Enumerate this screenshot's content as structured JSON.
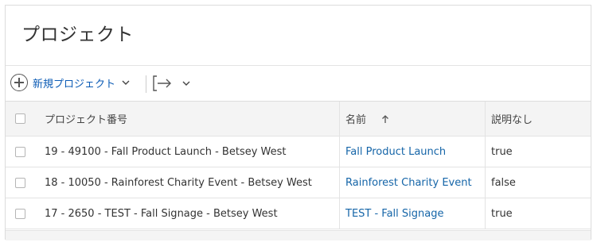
{
  "page": {
    "title": "プロジェクト"
  },
  "toolbar": {
    "new_project_label": "新規プロジェクト",
    "icons": {
      "add": "plus-circle-icon",
      "export": "export-arrow-icon"
    }
  },
  "table": {
    "columns": [
      {
        "key": "number",
        "label": "プロジェクト番号"
      },
      {
        "key": "name",
        "label": "名前",
        "sort": "ascending"
      },
      {
        "key": "no_description",
        "label": "説明なし"
      }
    ],
    "rows": [
      {
        "number": "19 - 49100 - Fall Product Launch - Betsey West",
        "name": "Fall Product Launch",
        "no_description": "true"
      },
      {
        "number": "18 - 10050 - Rainforest Charity Event - Betsey West",
        "name": "Rainforest Charity Event",
        "no_description": "false"
      },
      {
        "number": "17 - 2650 - TEST - Fall Signage - Betsey West",
        "name": "TEST - Fall Signage",
        "no_description": "true"
      }
    ]
  },
  "colors": {
    "link": "#1565a8",
    "accent": "#0b5bb5",
    "header_bg": "#f4f4f4"
  }
}
